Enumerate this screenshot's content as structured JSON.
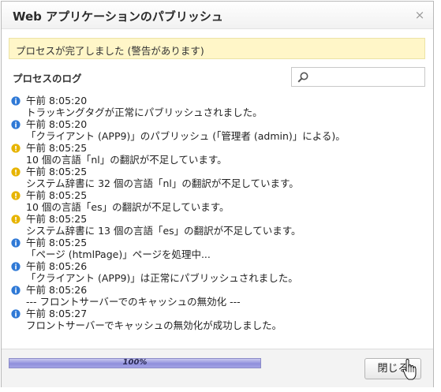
{
  "dialog": {
    "title": "Web アプリケーションのパブリッシュ",
    "close_glyph": "×"
  },
  "banner": {
    "text": "プロセスが完了しました (警告があります)",
    "color": "#fff6c8"
  },
  "log_section": {
    "title": "プロセスのログ",
    "search_placeholder": ""
  },
  "log": [
    {
      "icon": "info-icon",
      "time": "午前 8:05:20",
      "message": "トラッキングタグが正常にパブリッシュされました。"
    },
    {
      "icon": "info-icon",
      "time": "午前 8:05:20",
      "message": "「クライアント (APP9)」のパブリッシュ (「管理者 (admin)」による)。"
    },
    {
      "icon": "warning-icon",
      "time": "午前 8:05:25",
      "message": "10 個の言語「nl」の翻訳が不足しています。"
    },
    {
      "icon": "warning-icon",
      "time": "午前 8:05:25",
      "message": "システム辞書に 32 個の言語「nl」の翻訳が不足しています。"
    },
    {
      "icon": "warning-icon",
      "time": "午前 8:05:25",
      "message": "10 個の言語「es」の翻訳が不足しています。"
    },
    {
      "icon": "warning-icon",
      "time": "午前 8:05:25",
      "message": "システム辞書に 13 個の言語「es」の翻訳が不足しています。"
    },
    {
      "icon": "info-icon",
      "time": "午前 8:05:25",
      "message": "「ページ (htmlPage)」ページを処理中..."
    },
    {
      "icon": "info-icon",
      "time": "午前 8:05:26",
      "message": "「クライアント (APP9)」は正常にパブリッシュされました。"
    },
    {
      "icon": "info-icon",
      "time": "午前 8:05:26",
      "message": "--- フロントサーバーでのキャッシュの無効化 ---"
    },
    {
      "icon": "info-icon",
      "time": "午前 8:05:27",
      "message": "フロントサーバーでキャッシュの無効化が成功しました。"
    }
  ],
  "footer": {
    "progress_percent": 100,
    "progress_label": "100%",
    "close_button": "閉じる"
  },
  "colors": {
    "info": "#2f79d6",
    "warning": "#e7b400"
  }
}
